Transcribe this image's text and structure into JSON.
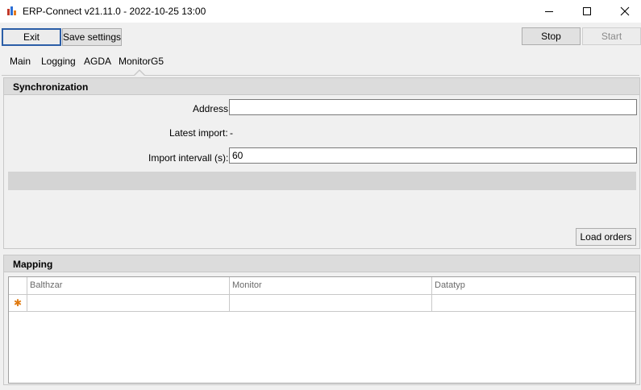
{
  "window": {
    "title": "ERP-Connect v21.11.0 - 2022-10-25 13:00",
    "icons": {
      "app": "app-icon",
      "minimize": "minimize-icon",
      "maximize": "maximize-icon",
      "close": "close-icon"
    }
  },
  "toolbar": {
    "exit_label": "Exit",
    "save_label": "Save settings",
    "stop_label": "Stop",
    "start_label": "Start"
  },
  "tabs": [
    {
      "label": "Main"
    },
    {
      "label": "Logging"
    },
    {
      "label": "AGDA"
    },
    {
      "label": "MonitorG5",
      "selected": true
    }
  ],
  "sync": {
    "title": "Synchronization",
    "address_label": "Address",
    "address_value": "",
    "latest_import_label": "Latest import:",
    "latest_import_value": "-",
    "interval_label": "Import intervall (s):",
    "interval_value": "60",
    "load_orders_label": "Load orders"
  },
  "mapping": {
    "title": "Mapping",
    "columns": [
      "Balthzar",
      "Monitor",
      "Datatyp"
    ],
    "new_row_marker": "✱",
    "rows": []
  },
  "colors": {
    "accent_border": "#2b5ea7",
    "new_row_marker": "#e07a10"
  }
}
